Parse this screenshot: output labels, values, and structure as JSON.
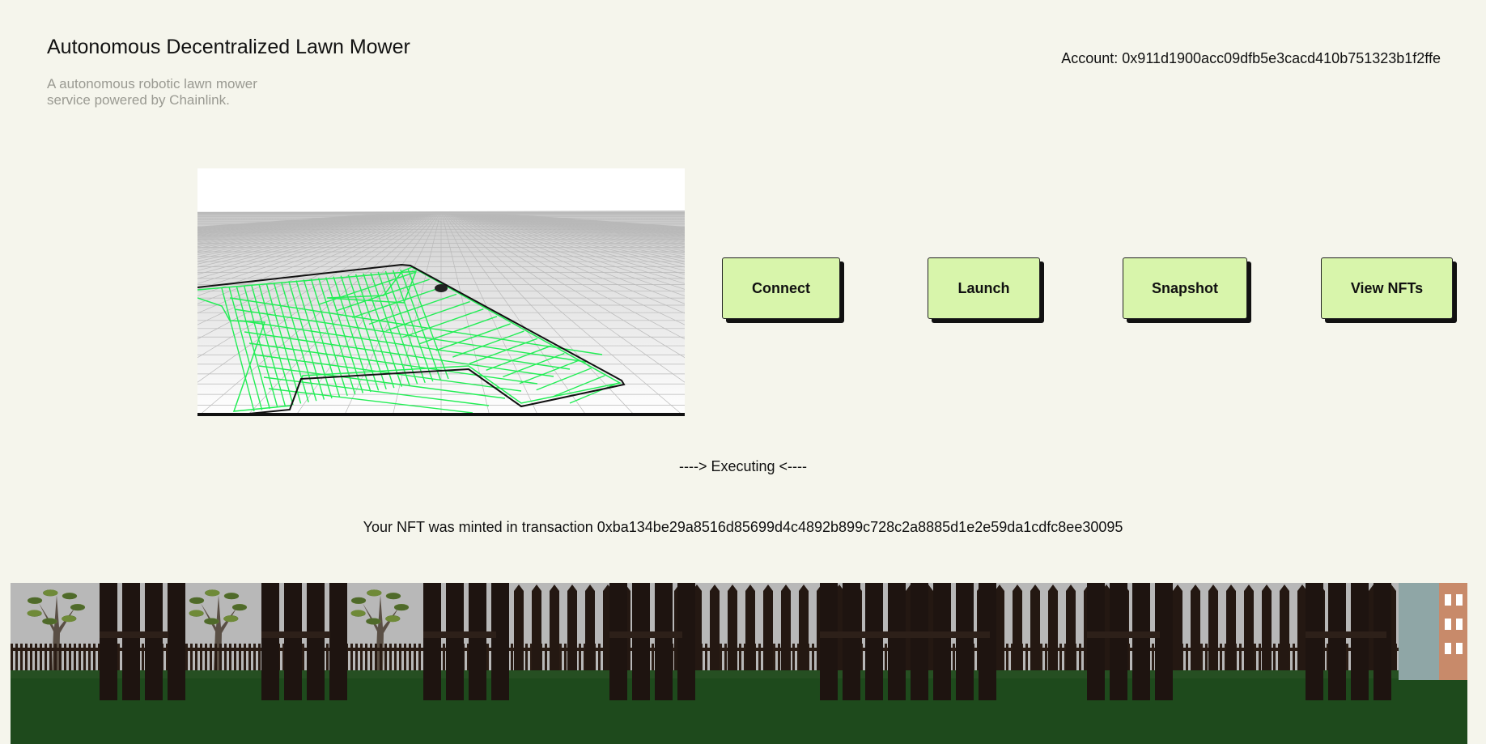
{
  "header": {
    "title": "Autonomous Decentralized Lawn Mower",
    "subtitle": "A autonomous robotic lawn mower service powered by Chainlink."
  },
  "account": {
    "label": "Account: 0x911d1900acc09dfb5e3cacd410b751323b1f2ffe"
  },
  "controls": {
    "connect_label": "Connect",
    "launch_label": "Launch",
    "snapshot_label": "Snapshot",
    "view_nfts_label": "View NFTs"
  },
  "status": {
    "text": "----> Executing <----"
  },
  "transaction": {
    "text": "Your NFT was minted in transaction 0xba134be29a8516d85699d4c4892b899c728c2a8885d1e2e59da1cdfc8ee30095"
  },
  "colors": {
    "background": "#f5f5ec",
    "button": "#d8f5ab",
    "mow_path": "#22ee55",
    "grass": "#1e4a1c",
    "fence": "#1e1410"
  }
}
